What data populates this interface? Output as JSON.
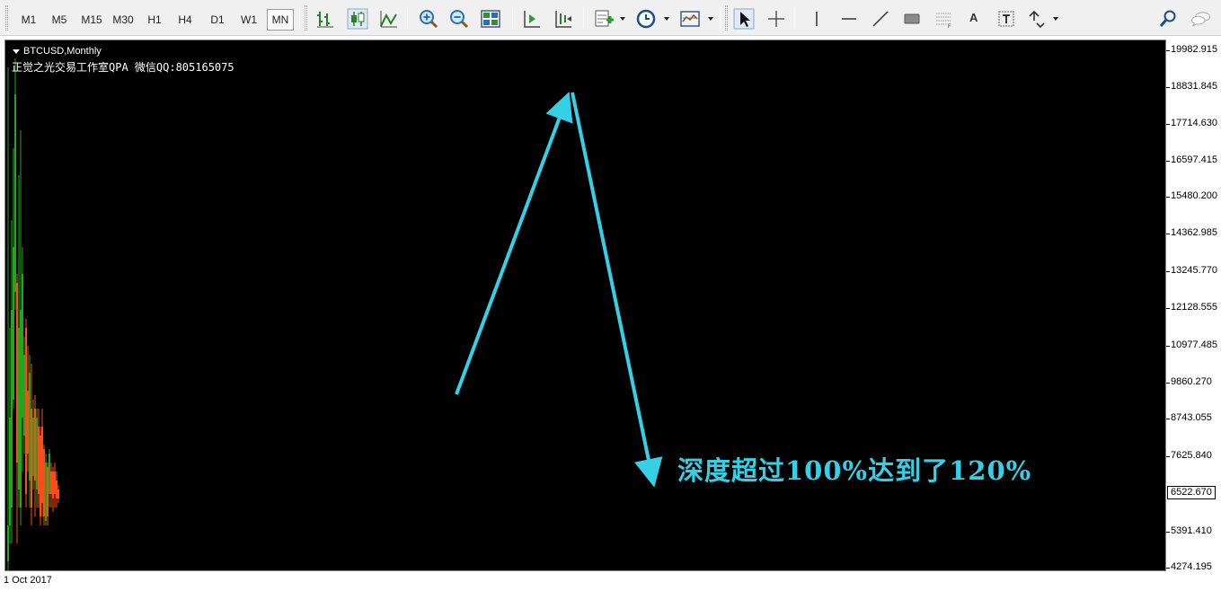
{
  "toolbar": {
    "timeframes": [
      "M1",
      "M5",
      "M15",
      "M30",
      "H1",
      "H4",
      "D1",
      "W1",
      "MN"
    ],
    "active_timeframe": "MN",
    "text_tool_label": "A",
    "tools": [
      "bar-chart-icon",
      "candlestick-chart-icon",
      "line-chart-icon",
      "zoom-in-icon",
      "zoom-out-icon",
      "tile-windows-icon",
      "chart-shift-icon",
      "autoscroll-icon",
      "indicators-icon",
      "periods-clock-icon",
      "templates-icon",
      "cursor-icon",
      "crosshair-icon",
      "vertical-line-icon",
      "horizontal-line-icon",
      "trendline-icon",
      "rectangle-icon",
      "fibonacci-icon",
      "text-icon",
      "text-label-icon",
      "arrows-icon",
      "search-icon",
      "chat-icon"
    ]
  },
  "chart": {
    "symbol": "BTCUSD,Monthly",
    "studio_text": "正觉之光交易工作室QPA 微信QQ:805165075",
    "annotation": "深度超过100%达到了120%",
    "annotation_color": "#35d0e6",
    "time_label": "1 Oct 2017",
    "current_price": "6522.670",
    "price_labels": [
      "19982.915",
      "18831.845",
      "17714.630",
      "16597.415",
      "15480.200",
      "14362.985",
      "13245.770",
      "12128.555",
      "10977.485",
      "9860.270",
      "8743.055",
      "7625.840",
      "5391.410",
      "4274.195"
    ],
    "bull_color": "#1fa81f",
    "bear_color": "#ff4a1c",
    "background": "#000000"
  }
}
